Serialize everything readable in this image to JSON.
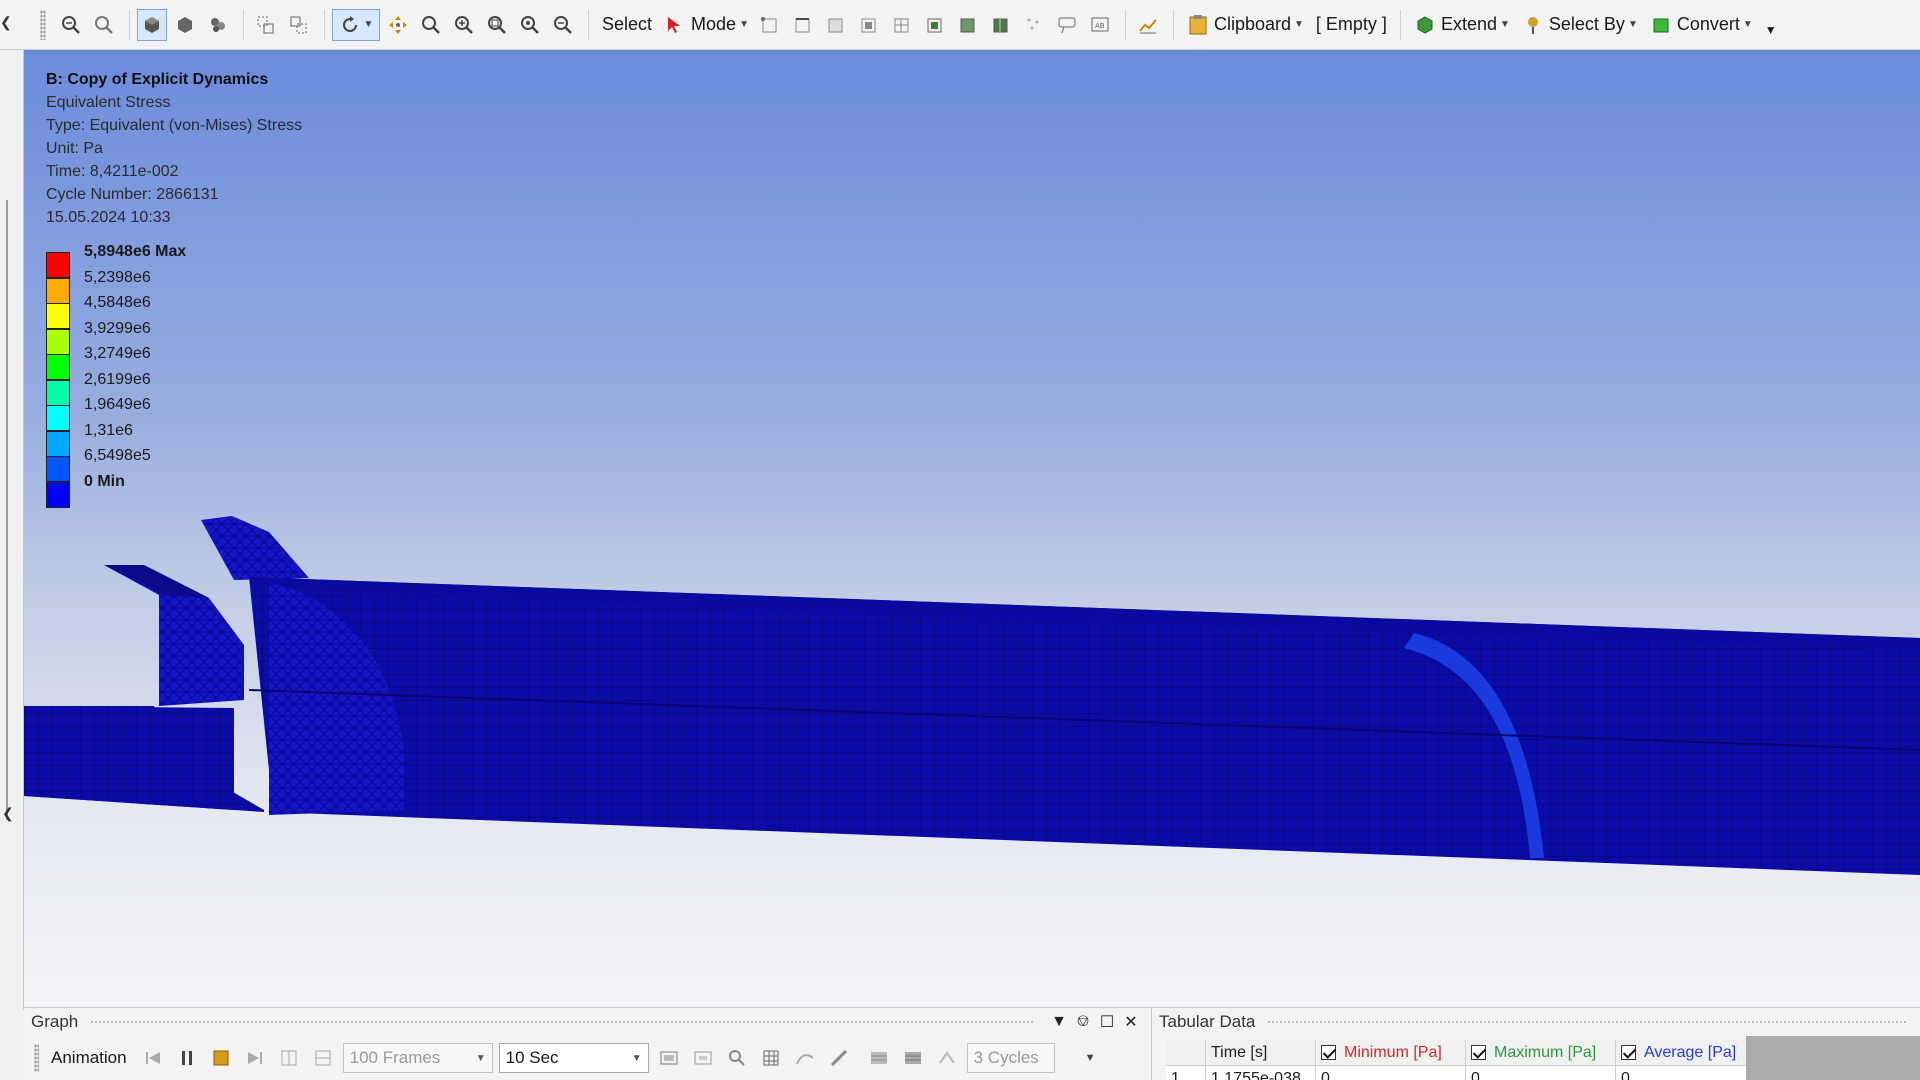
{
  "toolbar": {
    "select_label": "Select",
    "mode_label": "Mode",
    "clipboard_label": "Clipboard",
    "empty_label": "[ Empty ]",
    "extend_label": "Extend",
    "select_by_label": "Select By",
    "convert_label": "Convert"
  },
  "result": {
    "title": "B: Copy of Explicit Dynamics",
    "name": "Equivalent Stress",
    "type": "Type: Equivalent (von-Mises) Stress",
    "unit": "Unit: Pa",
    "time": "Time: 8,4211e-002",
    "cycle": "Cycle Number: 2866131",
    "date": "15.05.2024 10:33"
  },
  "legend": {
    "labels": [
      "5,8948e6 Max",
      "5,2398e6",
      "4,5848e6",
      "3,9299e6",
      "3,2749e6",
      "2,6199e6",
      "1,9649e6",
      "1,31e6",
      "6,5498e5",
      "0 Min"
    ],
    "colors": [
      "#ff0000",
      "#ffaa00",
      "#ffff00",
      "#aaff00",
      "#00ff00",
      "#00ffaa",
      "#00ffff",
      "#00aaff",
      "#0055ff",
      "#0000ff"
    ]
  },
  "mesh_color": "#0b0ba8",
  "graph": {
    "title": "Graph",
    "animation_label": "Animation",
    "frames": "100 Frames",
    "duration": "10 Sec",
    "cycles": "3 Cycles"
  },
  "tabular": {
    "title": "Tabular Data",
    "headers": [
      "",
      "Time [s]",
      "Minimum [Pa]",
      "Maximum [Pa]",
      "Average [Pa]"
    ],
    "row": [
      "1",
      "1,1755e-038",
      "0",
      "0",
      "0"
    ],
    "header_colors": [
      "#222222",
      "#222222",
      "#d42a2a",
      "#2a9a3a",
      "#2a3ad4"
    ]
  }
}
